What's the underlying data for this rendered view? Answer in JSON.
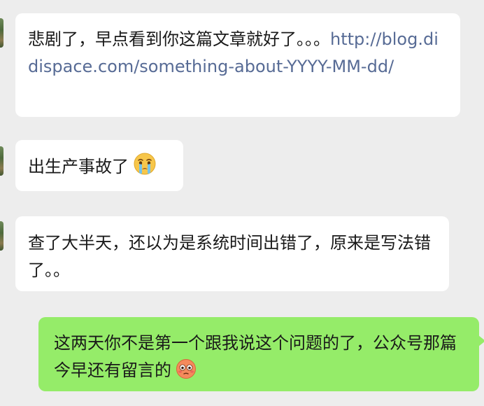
{
  "messages": [
    {
      "side": "incoming",
      "text": "悲剧了，早点看到你这篇文章就好了。。。",
      "link": "http://blog.didispace.com/something-about-YYYY-MM-dd/"
    },
    {
      "side": "incoming",
      "text": "出生产事故了",
      "emoji": "crying-face-emoji"
    },
    {
      "side": "incoming",
      "text": "查了大半天，还以为是系统时间出错了，原来是写法错了。。"
    },
    {
      "side": "outgoing",
      "text": "这两天你不是第一个跟我说这个问题的了，公众号那篇今早还有留言的",
      "emoji": "flushed-face-emoji"
    }
  ],
  "colors": {
    "background": "#ededed",
    "incoming_bubble": "#ffffff",
    "outgoing_bubble": "#95ec69",
    "link": "#576b95",
    "text": "#191919"
  }
}
